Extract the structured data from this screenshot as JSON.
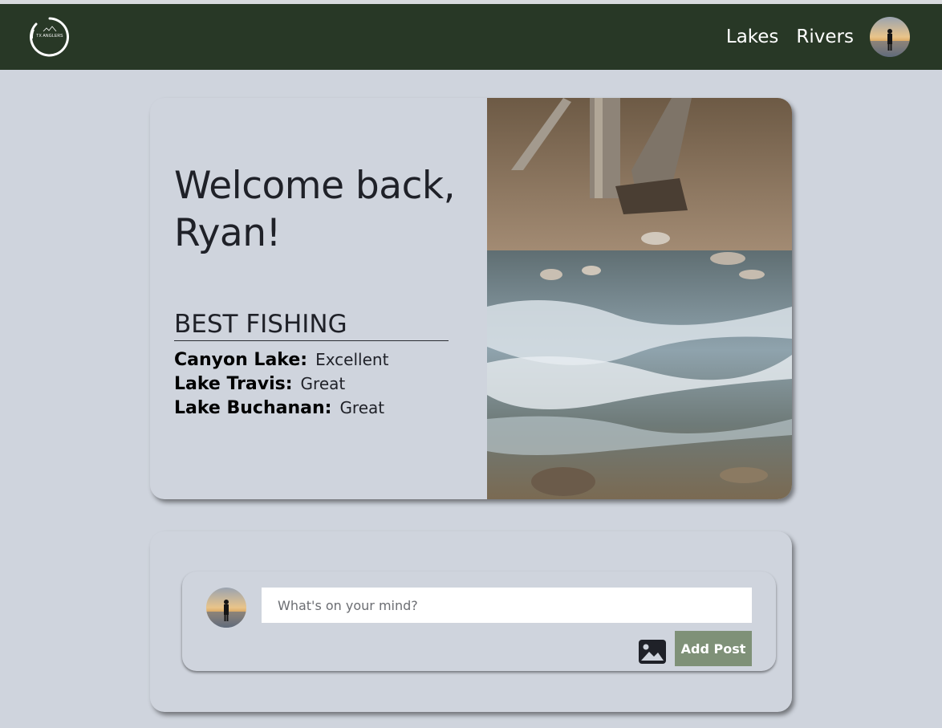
{
  "navbar": {
    "logo_text": "TX ANGLERS",
    "links": [
      {
        "label": "Lakes"
      },
      {
        "label": "Rivers"
      }
    ],
    "avatar_icon": "user-avatar"
  },
  "welcome": {
    "title": "Welcome back, Ryan!",
    "best_fishing_heading": "BEST FISHING",
    "lakes": [
      {
        "name": "Canyon Lake:",
        "rating": "Excellent"
      },
      {
        "name": "Lake Travis:",
        "rating": "Great"
      },
      {
        "name": "Lake Buchanan:",
        "rating": "Great"
      }
    ],
    "photo_icon": "river-photo"
  },
  "composer": {
    "placeholder": "What's on your mind?",
    "value": "",
    "image_icon": "image-icon",
    "add_post_label": "Add Post"
  },
  "colors": {
    "navbar": "#283826",
    "background": "#cfd4dd",
    "button": "#7f9178"
  }
}
